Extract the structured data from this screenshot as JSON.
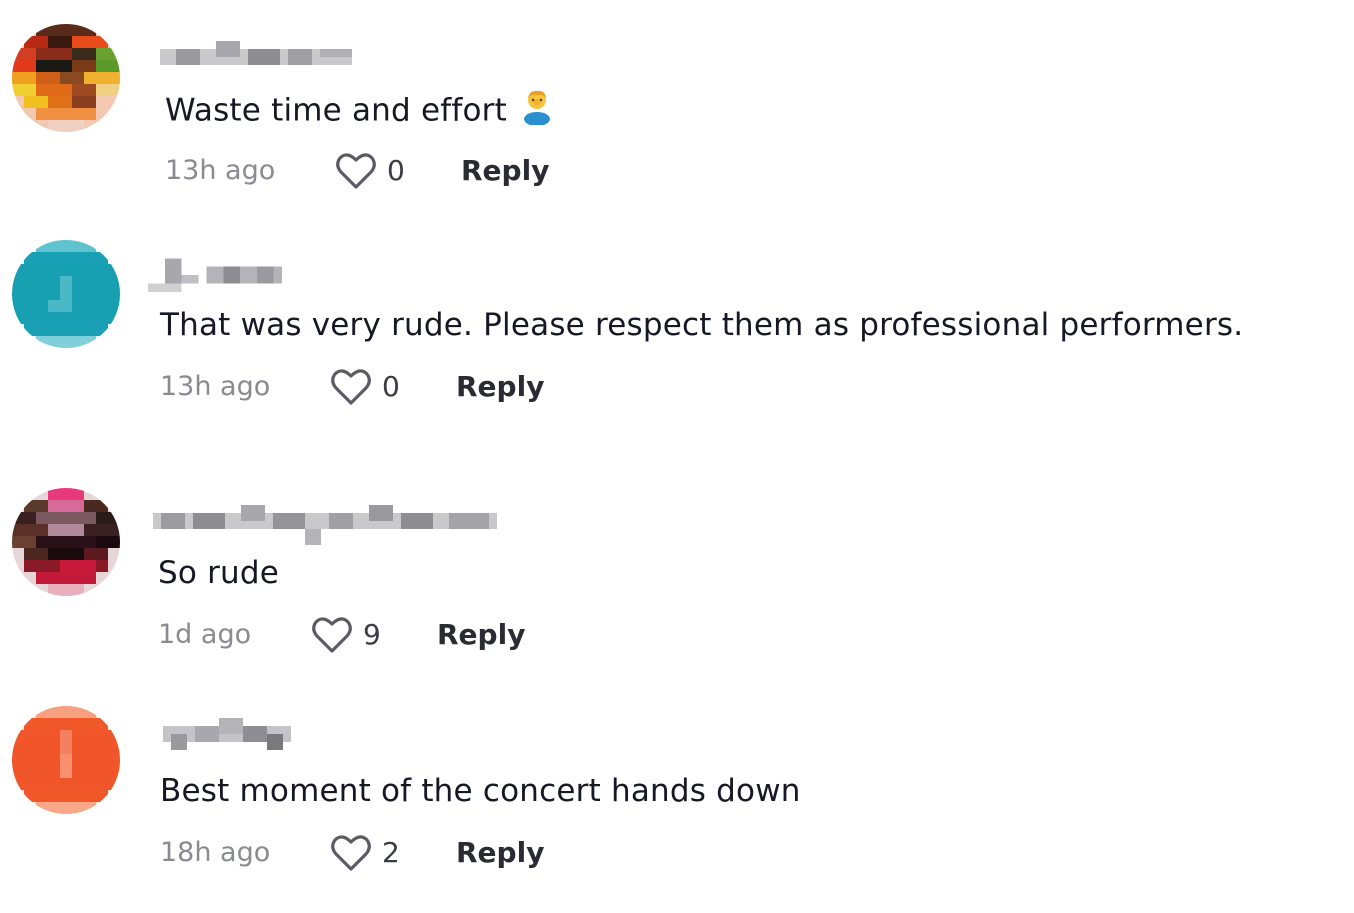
{
  "comments": [
    {
      "text": "Waste time and effort",
      "emoji_icon": "person-facepalming-icon",
      "timestamp": "13h ago",
      "likes": "0",
      "reply_label": "Reply",
      "avatar_color": "#e8541c"
    },
    {
      "text": "That was very rude. Please respect them as professional performers.",
      "timestamp": "13h ago",
      "likes": "0",
      "reply_label": "Reply",
      "avatar_color": "#1aa0b4"
    },
    {
      "text": "So rude",
      "timestamp": "1d ago",
      "likes": "9",
      "reply_label": "Reply",
      "avatar_color": "#6b3a3a"
    },
    {
      "text": "Best moment of the concert hands down",
      "timestamp": "18h ago",
      "likes": "2",
      "reply_label": "Reply",
      "avatar_color": "#f0582a"
    }
  ],
  "icons": {
    "like": "heart-outline-icon"
  }
}
